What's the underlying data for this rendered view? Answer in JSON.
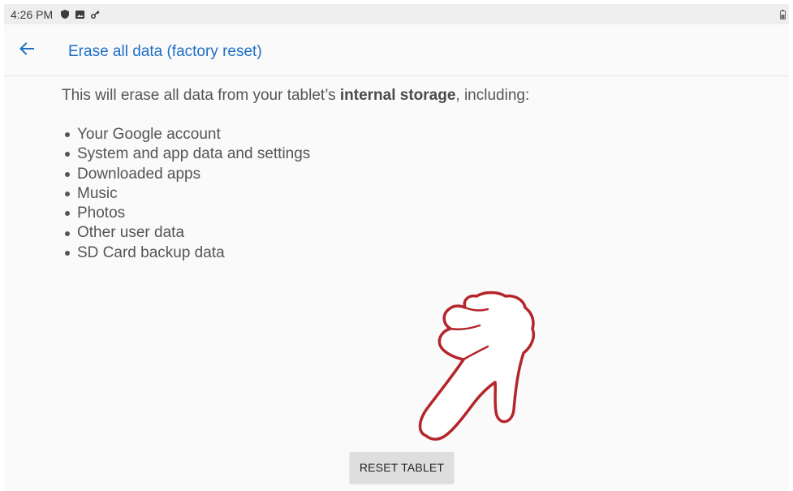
{
  "status_bar": {
    "time": "4:26 PM",
    "icons": [
      "shield-icon",
      "image-icon",
      "vpn-key-icon"
    ],
    "right_icon": "battery-icon"
  },
  "app_bar": {
    "back_icon": "arrow-back-icon",
    "title": "Erase all data (factory reset)"
  },
  "content": {
    "intro_before": "This will erase all data from your tablet’s ",
    "intro_bold": "internal storage",
    "intro_after": ", including:",
    "items": [
      "Your Google account",
      "System and app data and settings",
      "Downloaded apps",
      "Music",
      "Photos",
      "Other user data",
      "SD Card backup data"
    ]
  },
  "overlay": {
    "icon": "pointing-hand-icon"
  },
  "action": {
    "reset_label": "RESET TABLET"
  },
  "colors": {
    "accent": "#1e6fc4",
    "background": "#fafafa",
    "status_bar": "#eeeeee",
    "button": "#dedede",
    "hand_outline": "#b3262b"
  }
}
